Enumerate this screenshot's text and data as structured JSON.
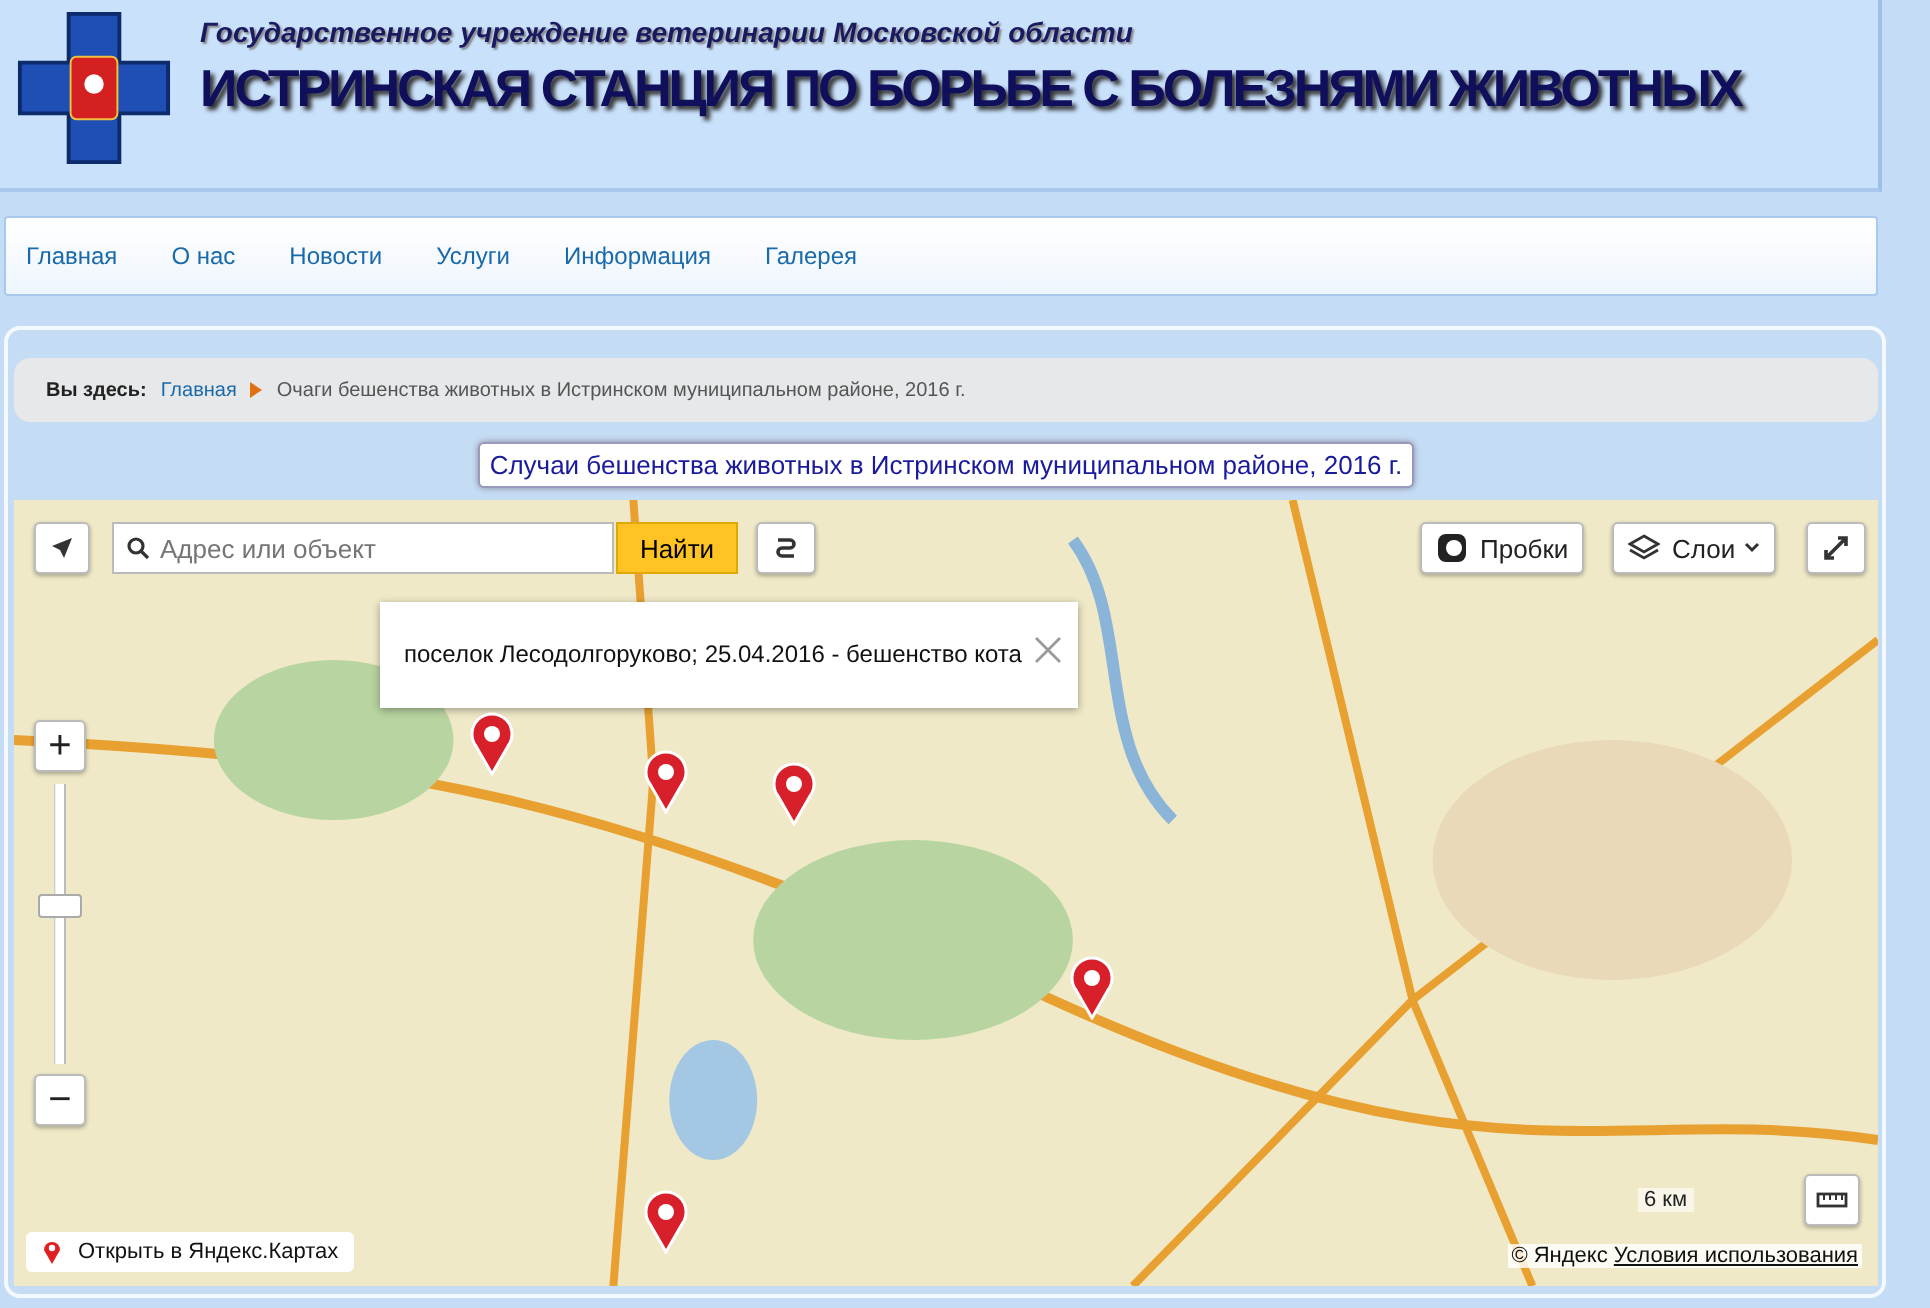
{
  "header": {
    "subtitle": "Государственное учреждение ветеринарии Московской области",
    "title": "ИСТРИНСКАЯ СТАНЦИЯ ПО БОРЬБЕ С БОЛЕЗНЯМИ ЖИВОТНЫХ"
  },
  "nav": [
    {
      "label": "Главная",
      "selected": false
    },
    {
      "label": "О нас",
      "selected": false
    },
    {
      "label": "Новости",
      "selected": false
    },
    {
      "label": "Услуги",
      "selected": false
    },
    {
      "label": "Информация",
      "selected": false
    },
    {
      "label": "Галерея",
      "selected": false
    }
  ],
  "breadcrumb": {
    "prefix": "Вы здесь:",
    "home": "Главная",
    "current": "Очаги бешенства животных в Истринском муниципальном районе, 2016 г."
  },
  "page_title": "Случаи бешенства животных в Истринском муниципальном районе, 2016 г.",
  "map": {
    "search_placeholder": "Адрес или объект",
    "search_button": "Найти",
    "traffic_button": "Пробки",
    "layers_button": "Слои",
    "popup": "поселок Лесодолгоруково; 25.04.2016 - бешенство кота",
    "zoom_in": "+",
    "zoom_out": "−",
    "open_link": "Открыть в Яндекс.Картах",
    "zoom_slider": {
      "level": 0.57
    },
    "scale": "6 км",
    "copyright": "© Яндекс",
    "terms": "Условия использования"
  }
}
